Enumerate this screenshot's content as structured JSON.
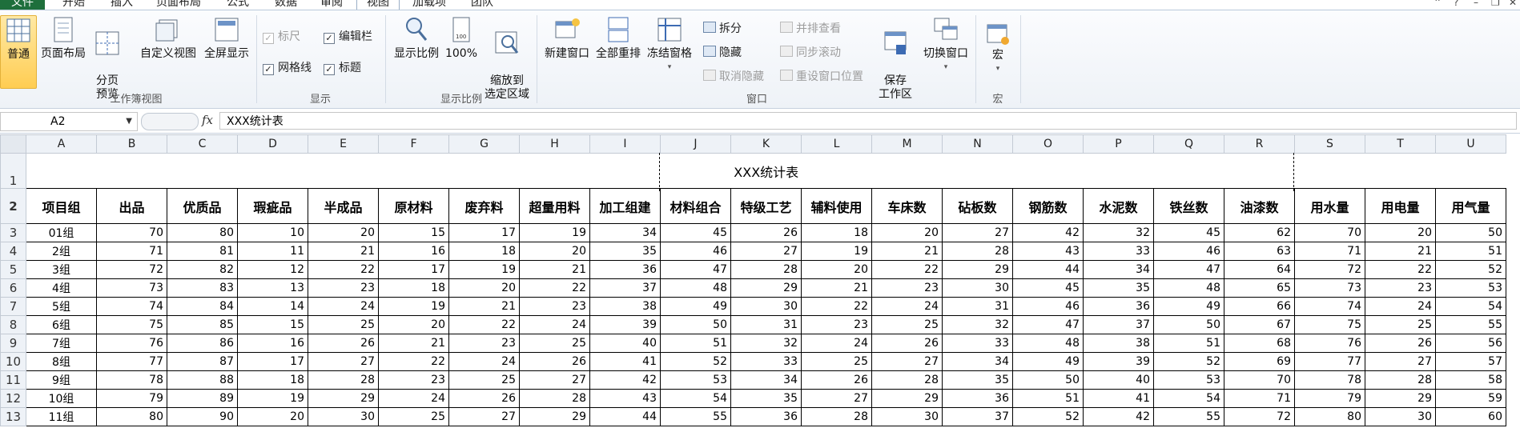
{
  "tabs": [
    "文件",
    "开始",
    "插入",
    "页面布局",
    "公式",
    "数据",
    "审阅",
    "视图",
    "加载项",
    "团队"
  ],
  "active_tab": "视图",
  "ribbon": {
    "workbook_views": {
      "label": "工作簿视图",
      "normal": "普通",
      "page_layout": "页面布局",
      "page_break": "分页\n预览",
      "custom_view": "自定义视图",
      "full_screen": "全屏显示"
    },
    "show": {
      "label": "显示",
      "ruler": "标尺",
      "formula_bar": "编辑栏",
      "gridlines": "网格线",
      "headings": "标题"
    },
    "zoom": {
      "label": "显示比例",
      "zoom": "显示比例",
      "hundred": "100%",
      "zoom_selection": "缩放到\n选定区域"
    },
    "window": {
      "label": "窗口",
      "new_window": "新建窗口",
      "arrange_all": "全部重排",
      "freeze_panes": "冻结窗格",
      "split": "拆分",
      "hide": "隐藏",
      "unhide": "取消隐藏",
      "side_by_side": "并排查看",
      "sync_scroll": "同步滚动",
      "reset_position": "重设窗口位置",
      "save_workspace": "保存\n工作区",
      "switch_windows": "切换窗口"
    },
    "macros": {
      "label": "宏",
      "macros": "宏"
    }
  },
  "formula_bar": {
    "name_box": "A2",
    "fx": "fx",
    "value": "XXX统计表"
  },
  "sheet": {
    "columns": [
      "A",
      "B",
      "C",
      "D",
      "E",
      "F",
      "G",
      "H",
      "I",
      "J",
      "K",
      "L",
      "M",
      "N",
      "O",
      "P",
      "Q",
      "R",
      "S",
      "T",
      "U"
    ],
    "title": "XXX统计表",
    "headers": [
      "项目组",
      "出品",
      "优质品",
      "瑕疵品",
      "半成品",
      "原材料",
      "废弃料",
      "超量用料",
      "加工组建",
      "材料组合",
      "特级工艺",
      "辅料使用",
      "车床数",
      "砧板数",
      "钢筋数",
      "水泥数",
      "铁丝数",
      "油漆数",
      "用水量",
      "用电量",
      "用气量"
    ],
    "rows": [
      {
        "n": "3",
        "g": "01组",
        "v": [
          70,
          80,
          10,
          20,
          15,
          17,
          19,
          34,
          45,
          26,
          18,
          20,
          27,
          42,
          32,
          45,
          62,
          70,
          20,
          50
        ]
      },
      {
        "n": "4",
        "g": "2组",
        "v": [
          71,
          81,
          11,
          21,
          16,
          18,
          20,
          35,
          46,
          27,
          19,
          21,
          28,
          43,
          33,
          46,
          63,
          71,
          21,
          51
        ]
      },
      {
        "n": "5",
        "g": "3组",
        "v": [
          72,
          82,
          12,
          22,
          17,
          19,
          21,
          36,
          47,
          28,
          20,
          22,
          29,
          44,
          34,
          47,
          64,
          72,
          22,
          52
        ]
      },
      {
        "n": "6",
        "g": "4组",
        "v": [
          73,
          83,
          13,
          23,
          18,
          20,
          22,
          37,
          48,
          29,
          21,
          23,
          30,
          45,
          35,
          48,
          65,
          73,
          23,
          53
        ]
      },
      {
        "n": "7",
        "g": "5组",
        "v": [
          74,
          84,
          14,
          24,
          19,
          21,
          23,
          38,
          49,
          30,
          22,
          24,
          31,
          46,
          36,
          49,
          66,
          74,
          24,
          54
        ]
      },
      {
        "n": "8",
        "g": "6组",
        "v": [
          75,
          85,
          15,
          25,
          20,
          22,
          24,
          39,
          50,
          31,
          23,
          25,
          32,
          47,
          37,
          50,
          67,
          75,
          25,
          55
        ]
      },
      {
        "n": "9",
        "g": "7组",
        "v": [
          76,
          86,
          16,
          26,
          21,
          23,
          25,
          40,
          51,
          32,
          24,
          26,
          33,
          48,
          38,
          51,
          68,
          76,
          26,
          56
        ]
      },
      {
        "n": "10",
        "g": "8组",
        "v": [
          77,
          87,
          17,
          27,
          22,
          24,
          26,
          41,
          52,
          33,
          25,
          27,
          34,
          49,
          39,
          52,
          69,
          77,
          27,
          57
        ]
      },
      {
        "n": "11",
        "g": "9组",
        "v": [
          78,
          88,
          18,
          28,
          23,
          25,
          27,
          42,
          53,
          34,
          26,
          28,
          35,
          50,
          40,
          53,
          70,
          78,
          28,
          58
        ]
      },
      {
        "n": "12",
        "g": "10组",
        "v": [
          79,
          89,
          19,
          29,
          24,
          26,
          28,
          43,
          54,
          35,
          27,
          29,
          36,
          51,
          41,
          54,
          71,
          79,
          29,
          59
        ]
      },
      {
        "n": "13",
        "g": "11组",
        "v": [
          80,
          90,
          20,
          30,
          25,
          27,
          29,
          44,
          55,
          36,
          28,
          30,
          37,
          52,
          42,
          55,
          72,
          80,
          30,
          60
        ]
      }
    ]
  }
}
